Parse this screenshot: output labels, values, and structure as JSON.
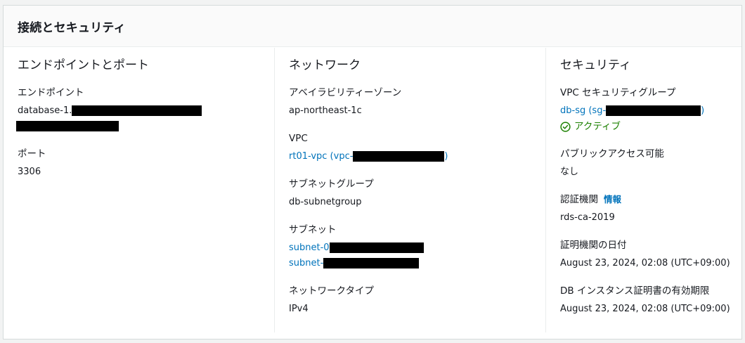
{
  "panel": {
    "title": "接続とセキュリティ"
  },
  "endpoint_port": {
    "title": "エンドポイントとポート",
    "endpoint_label": "エンドポイント",
    "endpoint_prefix": "database-1.",
    "port_label": "ポート",
    "port_value": "3306"
  },
  "network": {
    "title": "ネットワーク",
    "az_label": "アベイラビリティーゾーン",
    "az_value": "ap-northeast-1c",
    "vpc_label": "VPC",
    "vpc_prefix": "rt01-vpc (vpc-",
    "vpc_suffix": ")",
    "subnet_group_label": "サブネットグループ",
    "subnet_group_value": "db-subnetgroup",
    "subnet_label": "サブネット",
    "subnets": [
      "subnet-0",
      "subnet-"
    ],
    "network_type_label": "ネットワークタイプ",
    "network_type_value": "IPv4"
  },
  "security": {
    "title": "セキュリティ",
    "sg_label": "VPC セキュリティグループ",
    "sg_prefix": "db-sg (sg-",
    "sg_suffix": ")",
    "sg_status": "アクティブ",
    "public_access_label": "パブリックアクセス可能",
    "public_access_value": "なし",
    "ca_label": "認証機関",
    "ca_info": "情報",
    "ca_value": "rds-ca-2019",
    "ca_date_label": "証明機関の日付",
    "ca_date_value": "August 23, 2024, 02:08 (UTC+09:00)",
    "cert_expiry_label": "DB インスタンス証明書の有効期限",
    "cert_expiry_value": "August 23, 2024, 02:08 (UTC+09:00)"
  },
  "colors": {
    "link": "#0073bb",
    "success": "#1d8102",
    "border": "#eaeded"
  }
}
